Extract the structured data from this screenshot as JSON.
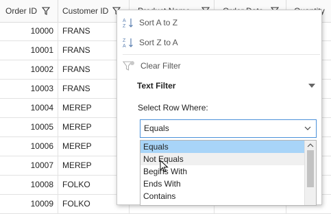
{
  "headers": [
    {
      "label": "Order ID"
    },
    {
      "label": "Customer ID"
    },
    {
      "label": "Product Name"
    },
    {
      "label": "Order Date"
    },
    {
      "label": "Quantity"
    }
  ],
  "rows": [
    {
      "order_id": "10000",
      "customer_id": "FRANS"
    },
    {
      "order_id": "10001",
      "customer_id": "FRANS"
    },
    {
      "order_id": "10002",
      "customer_id": "FRANS"
    },
    {
      "order_id": "10003",
      "customer_id": "FRANS"
    },
    {
      "order_id": "10004",
      "customer_id": "MEREP"
    },
    {
      "order_id": "10005",
      "customer_id": "MEREP"
    },
    {
      "order_id": "10006",
      "customer_id": "MEREP"
    },
    {
      "order_id": "10007",
      "customer_id": "MEREP"
    },
    {
      "order_id": "10008",
      "customer_id": "FOLKO"
    },
    {
      "order_id": "10009",
      "customer_id": "FOLKO"
    }
  ],
  "filter_menu": {
    "sort_asc": "Sort A to Z",
    "sort_desc": "Sort Z to A",
    "clear_filter": "Clear Filter",
    "text_filter": "Text Filter",
    "select_row_where": "Select Row Where:",
    "condition_value": "Equals",
    "options": [
      "Equals",
      "Not Equals",
      "Begins With",
      "Ends With",
      "Contains"
    ]
  },
  "colors": {
    "selected_option": "#a8d4f8",
    "combo_border": "#4a90d9"
  }
}
